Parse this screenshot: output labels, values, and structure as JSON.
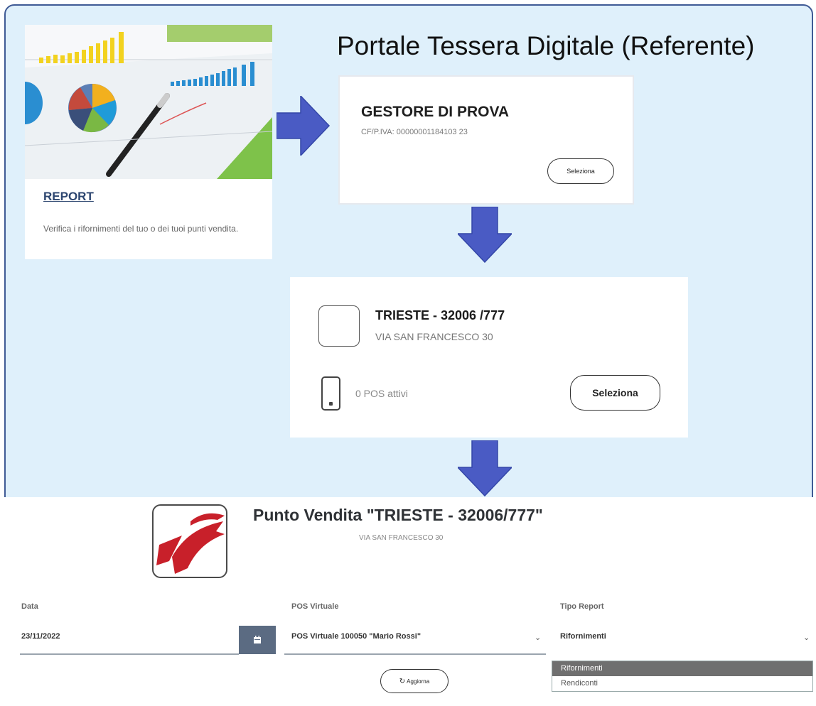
{
  "title": "Portale Tessera Digitale (Referente)",
  "report_card": {
    "link": "REPORT",
    "description": "Verifica i rifornimenti del tuo o dei tuoi punti vendita."
  },
  "gestore": {
    "name": "GESTORE DI PROVA",
    "cf": "CF/P.IVA: 00000001184103 23",
    "button": "Seleziona"
  },
  "punto_vendita_card": {
    "name": "TRIESTE - 32006 /777",
    "address": "VIA SAN FRANCESCO 30",
    "pos_count": "0 POS attivi",
    "button": "Seleziona"
  },
  "report_panel": {
    "heading": "Punto Vendita \"TRIESTE - 32006/777\"",
    "address": "VIA SAN FRANCESCO 30",
    "data": {
      "label": "Data",
      "value": "23/11/2022"
    },
    "pos": {
      "label": "POS Virtuale",
      "value": "POS Virtuale 100050 \"Mario Rossi\""
    },
    "tipo": {
      "label": "Tipo Report",
      "value": "Rifornimenti"
    },
    "refresh_button": "Aggiorna",
    "dropdown_options": [
      "Rifornimenti",
      "Rendiconti"
    ]
  },
  "colors": {
    "frame_bg": "#dff0fb",
    "frame_border": "#3f5a95",
    "arrow": "#4a5bc4",
    "brand_red": "#c8202a",
    "link": "#2d4670"
  }
}
